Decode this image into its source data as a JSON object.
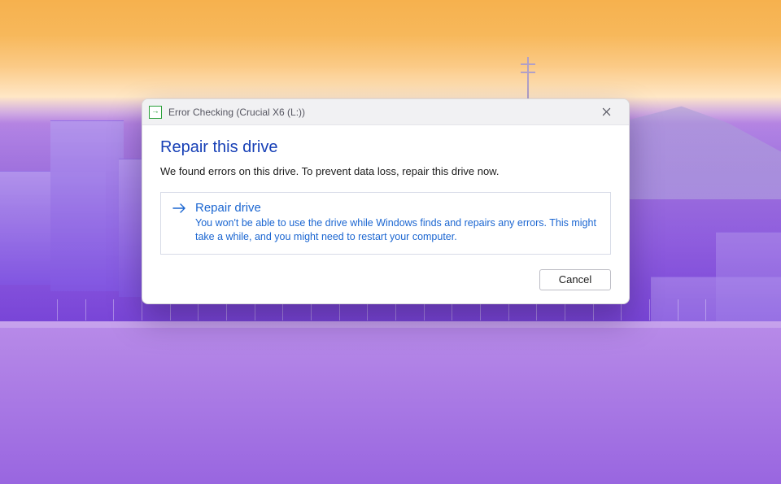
{
  "window": {
    "title": "Error Checking (Crucial X6 (L:))"
  },
  "dialog": {
    "heading": "Repair this drive",
    "message": "We found errors on this drive. To prevent data loss, repair this drive now.",
    "option": {
      "title": "Repair drive",
      "description": "You won't be able to use the drive while Windows finds and repairs any errors. This might take a while, and you might need to restart your computer."
    },
    "cancel_label": "Cancel"
  },
  "colors": {
    "accent_blue": "#1b66d1",
    "heading_blue": "#163fb6",
    "icon_green": "#2aa03a"
  }
}
